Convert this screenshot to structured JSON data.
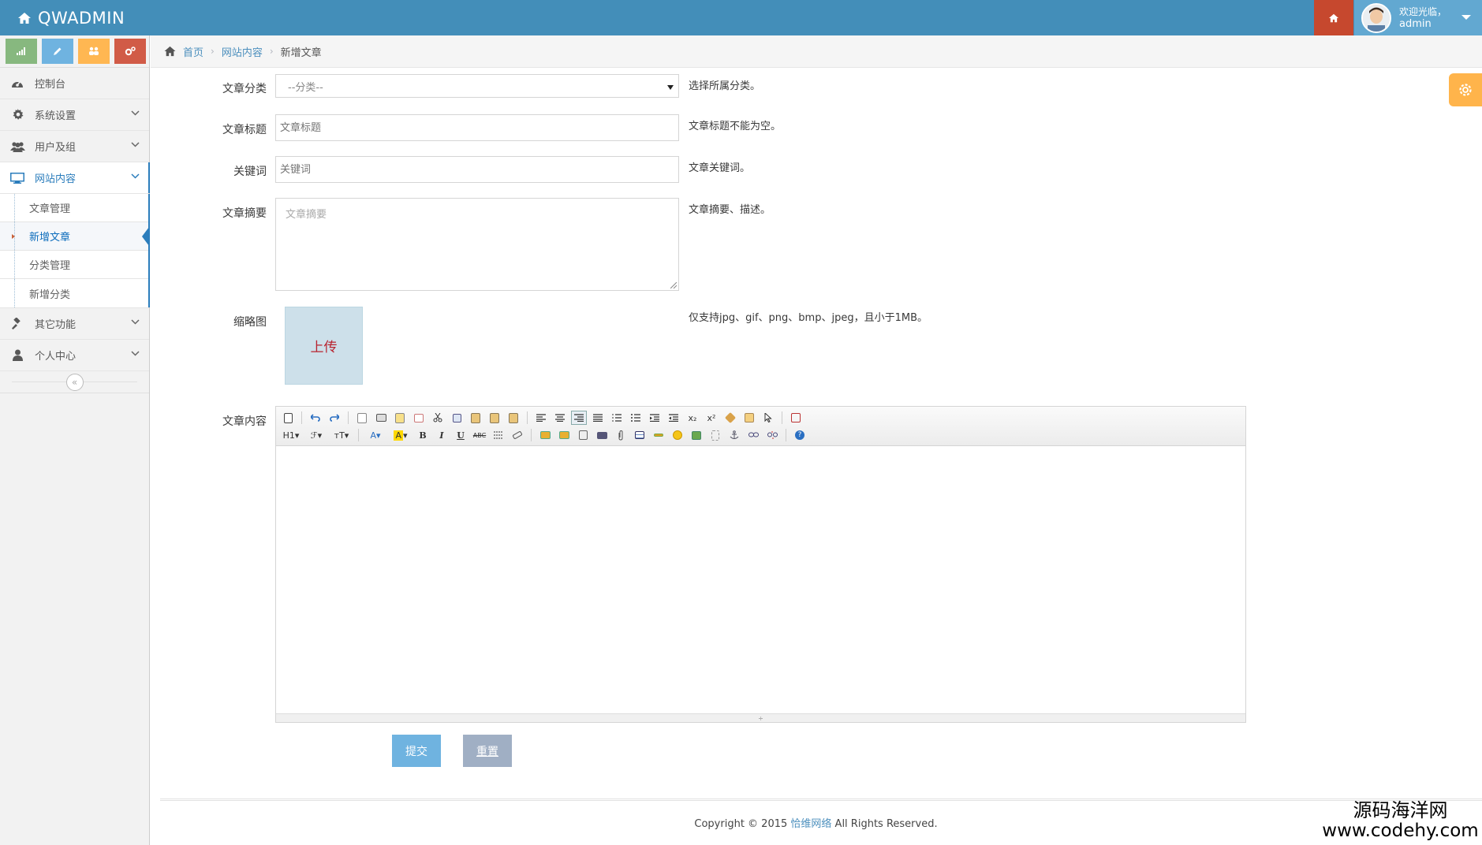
{
  "app": {
    "brand": "QWADMIN"
  },
  "user": {
    "greeting": "欢迎光临，",
    "name": "admin"
  },
  "sidebar": {
    "shortcuts": [
      "chart-icon",
      "pencil-icon",
      "users-icon",
      "cogs-icon"
    ],
    "items": [
      {
        "label": "控制台",
        "icon": "dashboard-icon"
      },
      {
        "label": "系统设置",
        "icon": "gear-icon"
      },
      {
        "label": "用户及组",
        "icon": "users-icon"
      },
      {
        "label": "网站内容",
        "icon": "desktop-icon",
        "active": true
      },
      {
        "label": "其它功能",
        "icon": "gavel-icon"
      },
      {
        "label": "个人中心",
        "icon": "user-icon"
      }
    ],
    "submenu": [
      "文章管理",
      "新增文章",
      "分类管理",
      "新增分类"
    ],
    "active_submenu": "新增文章",
    "collapse": "«"
  },
  "breadcrumb": {
    "home": "首页",
    "parent": "网站内容",
    "current": "新增文章",
    "separator": "›"
  },
  "form": {
    "category": {
      "label": "文章分类",
      "value": "--分类--",
      "help": "选择所属分类。"
    },
    "title": {
      "label": "文章标题",
      "placeholder": "文章标题",
      "help": "文章标题不能为空。"
    },
    "keywords": {
      "label": "关键词",
      "placeholder": "关键词",
      "help": "文章关键词。"
    },
    "summary": {
      "label": "文章摘要",
      "placeholder": "文章摘要",
      "help": "文章摘要、描述。"
    },
    "thumbnail": {
      "label": "缩略图",
      "upload": "上传",
      "help": "仅支持jpg、gif、png、bmp、jpeg，且小于1MB。"
    },
    "content": {
      "label": "文章内容"
    },
    "submit": "提交",
    "reset": "重置"
  },
  "editor": {
    "row1_text": {
      "sub": "x₂",
      "sup": "x²"
    },
    "row2_text": {
      "heading": "H1",
      "font": "ℱ",
      "size": "тT",
      "fontcolor": "A",
      "bgcolor": "A",
      "bold": "B",
      "italic": "I",
      "underline": "U",
      "strike": "ABC"
    },
    "resize_handle": "÷"
  },
  "footer": {
    "prefix": "Copyright © 2015 ",
    "link": "恰维网络",
    "suffix": " All Rights Reserved."
  },
  "watermark": {
    "line1": "源码海洋网",
    "line2": "www.codehy.com"
  },
  "colors": {
    "navbar": "#438eb9",
    "home_button": "#c6482e",
    "user_area": "#62a8d1",
    "accent": "#2b7dbc"
  }
}
